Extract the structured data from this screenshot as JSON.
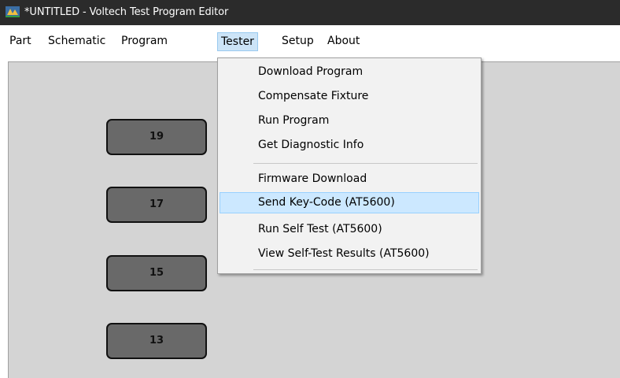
{
  "window": {
    "title": "*UNTITLED - Voltech Test Program Editor",
    "icon": "voltech-app-icon"
  },
  "menubar": {
    "items": [
      "Part",
      "Schematic",
      "Program",
      "Tester",
      "Setup",
      "About"
    ],
    "active": "Tester"
  },
  "pins": [
    "19",
    "17",
    "15",
    "13"
  ],
  "tester_menu": {
    "group1": [
      "Download Program",
      "Compensate Fixture",
      "Run Program",
      "Get Diagnostic Info"
    ],
    "group2": [
      "Firmware Download",
      "Send Key-Code (AT5600)",
      "Run Self Test (AT5600)",
      "View Self-Test Results (AT5600)"
    ],
    "highlighted": "Send Key-Code (AT5600)"
  },
  "colors": {
    "titlebar": "#2b2b2b",
    "workspace": "#d4d4d4",
    "pin_fill": "#696969",
    "menu_highlight": "#cce8ff"
  }
}
